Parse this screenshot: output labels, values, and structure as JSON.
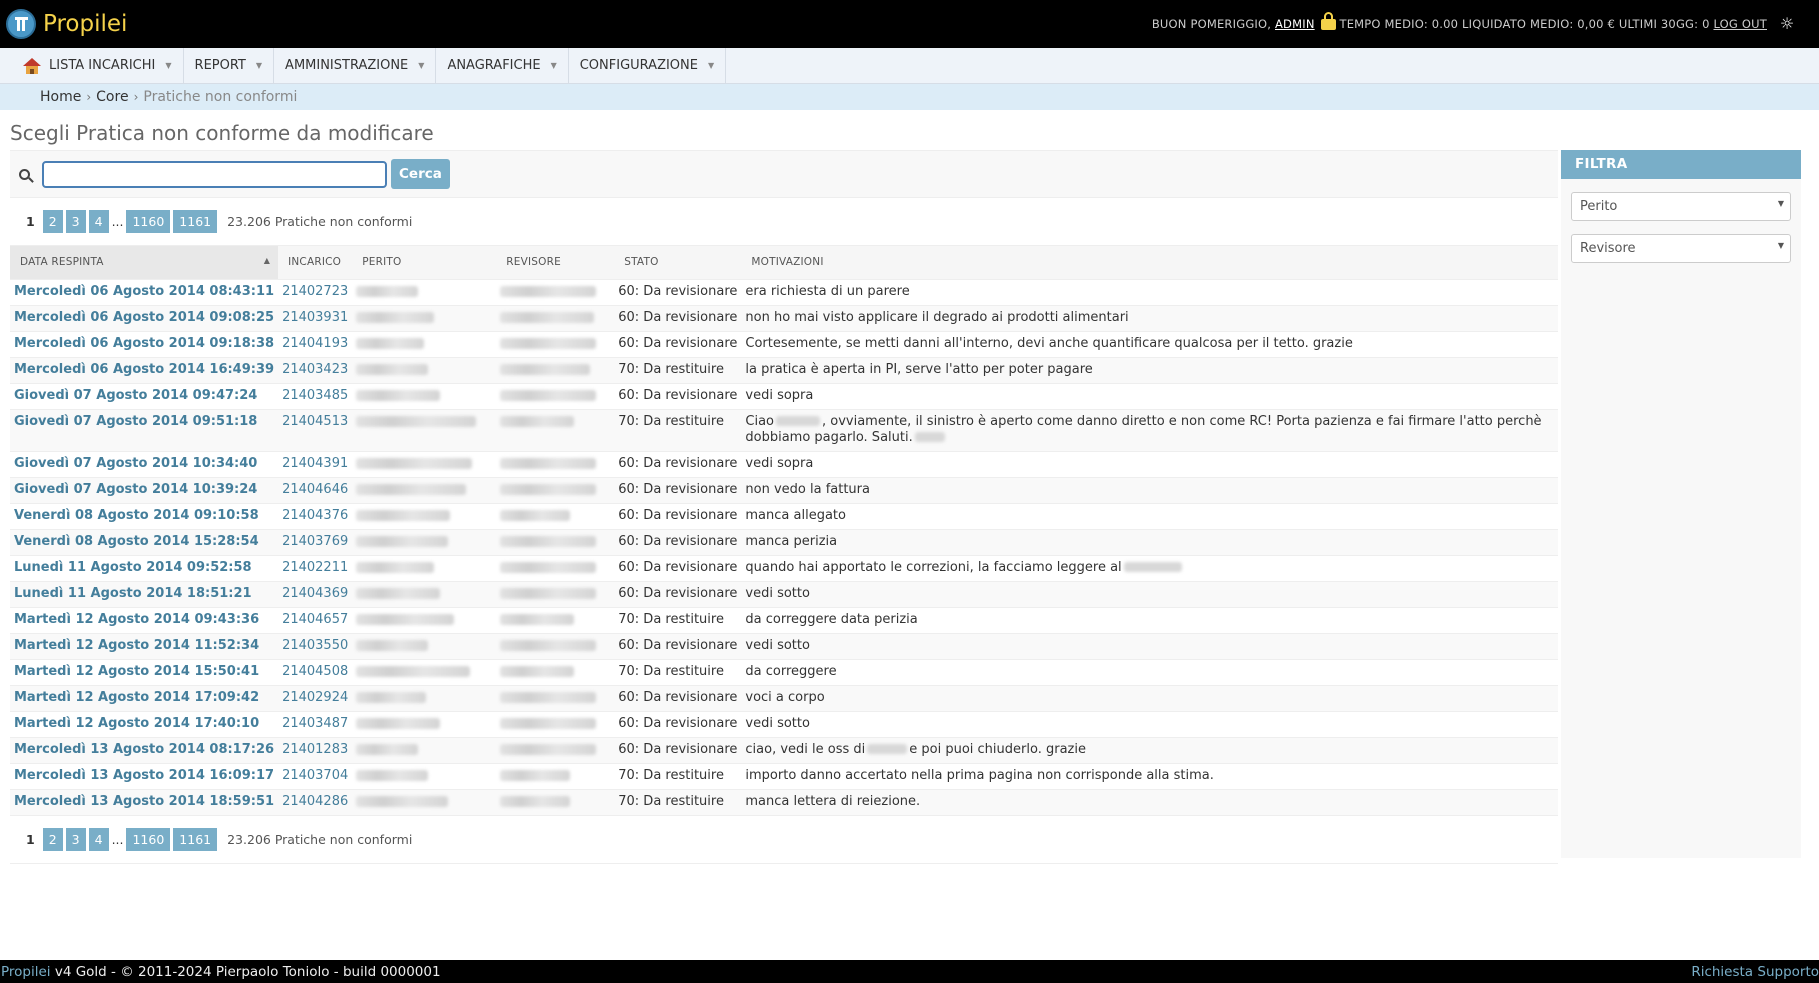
{
  "app": {
    "name": "Propilei"
  },
  "user_tools": {
    "greeting": "BUON POMERIGGIO,",
    "user": "ADMIN",
    "stats": "TEMPO MEDIO: 0.00 LIQUIDATO MEDIO: 0,00 € ULTIMI 30GG: 0",
    "logout": "LOG OUT"
  },
  "nav": [
    {
      "label": "LISTA INCARICHI"
    },
    {
      "label": "REPORT"
    },
    {
      "label": "AMMINISTRAZIONE"
    },
    {
      "label": "ANAGRAFICHE"
    },
    {
      "label": "CONFIGURAZIONE"
    }
  ],
  "breadcrumb": {
    "home": "Home",
    "core": "Core",
    "current": "Pratiche non conformi"
  },
  "page_title": "Scegli Pratica non conforme da modificare",
  "search": {
    "value": "",
    "button": "Cerca"
  },
  "paginator": {
    "current": "1",
    "pages": [
      "2",
      "3",
      "4"
    ],
    "ellipsis": "...",
    "last_pages": [
      "1160",
      "1161"
    ],
    "count": "23.206 Pratiche non conformi"
  },
  "table": {
    "headers": [
      "DATA RESPINTA",
      "INCARICO",
      "PERITO",
      "REVISORE",
      "STATO",
      "MOTIVAZIONI"
    ],
    "rows": [
      {
        "date": "Mercoledì 06 Agosto 2014 08:43:11",
        "inc": "21402723",
        "stato": "60: Da revisionare",
        "mot": "era richiesta di un parere"
      },
      {
        "date": "Mercoledì 06 Agosto 2014 09:08:25",
        "inc": "21403931",
        "stato": "60: Da revisionare",
        "mot": "non ho mai visto applicare il degrado ai prodotti alimentari"
      },
      {
        "date": "Mercoledì 06 Agosto 2014 09:18:38",
        "inc": "21404193",
        "stato": "60: Da revisionare",
        "mot": "Cortesemente, se metti danni all'interno, devi anche quantificare qualcosa per il tetto. grazie"
      },
      {
        "date": "Mercoledì 06 Agosto 2014 16:49:39",
        "inc": "21403423",
        "stato": "70: Da restituire",
        "mot": "la pratica è aperta in PI, serve l'atto per poter pagare"
      },
      {
        "date": "Giovedì 07 Agosto 2014 09:47:24",
        "inc": "21403485",
        "stato": "60: Da revisionare",
        "mot": "vedi sopra"
      },
      {
        "date": "Giovedì 07 Agosto 2014 09:51:18",
        "inc": "21404513",
        "stato": "70: Da restituire",
        "mot_a": "Ciao",
        "mot_b": ", ovviamente, il sinistro è aperto come danno diretto e non come RC! Porta pazienza e fai firmare l'atto perchè dobbiamo pagarlo. Saluti."
      },
      {
        "date": "Giovedì 07 Agosto 2014 10:34:40",
        "inc": "21404391",
        "stato": "60: Da revisionare",
        "mot": "vedi sopra"
      },
      {
        "date": "Giovedì 07 Agosto 2014 10:39:24",
        "inc": "21404646",
        "stato": "60: Da revisionare",
        "mot": "non vedo la fattura"
      },
      {
        "date": "Venerdì 08 Agosto 2014 09:10:58",
        "inc": "21404376",
        "stato": "60: Da revisionare",
        "mot": "manca allegato"
      },
      {
        "date": "Venerdì 08 Agosto 2014 15:28:54",
        "inc": "21403769",
        "stato": "60: Da revisionare",
        "mot": "manca perizia"
      },
      {
        "date": "Lunedì 11 Agosto 2014 09:52:58",
        "inc": "21402211",
        "stato": "60: Da revisionare",
        "mot": "quando hai apportato le correzioni, la facciamo leggere al"
      },
      {
        "date": "Lunedì 11 Agosto 2014 18:51:21",
        "inc": "21404369",
        "stato": "60: Da revisionare",
        "mot": "vedi sotto"
      },
      {
        "date": "Martedì 12 Agosto 2014 09:43:36",
        "inc": "21404657",
        "stato": "70: Da restituire",
        "mot": "da correggere data perizia"
      },
      {
        "date": "Martedì 12 Agosto 2014 11:52:34",
        "inc": "21403550",
        "stato": "60: Da revisionare",
        "mot": "vedi sotto"
      },
      {
        "date": "Martedì 12 Agosto 2014 15:50:41",
        "inc": "21404508",
        "stato": "70: Da restituire",
        "mot": "da correggere"
      },
      {
        "date": "Martedì 12 Agosto 2014 17:09:42",
        "inc": "21402924",
        "stato": "60: Da revisionare",
        "mot": "voci a corpo"
      },
      {
        "date": "Martedì 12 Agosto 2014 17:40:10",
        "inc": "21403487",
        "stato": "60: Da revisionare",
        "mot": "vedi sotto"
      },
      {
        "date": "Mercoledì 13 Agosto 2014 08:17:26",
        "inc": "21401283",
        "stato": "60: Da revisionare",
        "mot_a": "ciao, vedi le oss di",
        "mot_b": "e poi puoi chiuderlo. grazie"
      },
      {
        "date": "Mercoledì 13 Agosto 2014 16:09:17",
        "inc": "21403704",
        "stato": "70: Da restituire",
        "mot": "importo danno accertato nella prima pagina non corrisponde alla stima."
      },
      {
        "date": "Mercoledì 13 Agosto 2014 18:59:51",
        "inc": "21404286",
        "stato": "70: Da restituire",
        "mot": "manca lettera di reiezione."
      }
    ]
  },
  "filter": {
    "title": "FILTRA",
    "selects": [
      "Perito",
      "Revisore"
    ]
  },
  "footer": {
    "brand": "Propilei",
    "text": " v4 Gold - © 2011-2024 Pierpaolo Toniolo - build 0000001",
    "support": "Richiesta Supporto"
  },
  "icons": [
    "logo-icon",
    "lock-icon",
    "sun-icon",
    "home-icon",
    "search-icon"
  ],
  "colors": {
    "accent": "#79aec8",
    "link": "#447e9b",
    "brand": "#f5d24a",
    "header_bg": "#000000"
  }
}
